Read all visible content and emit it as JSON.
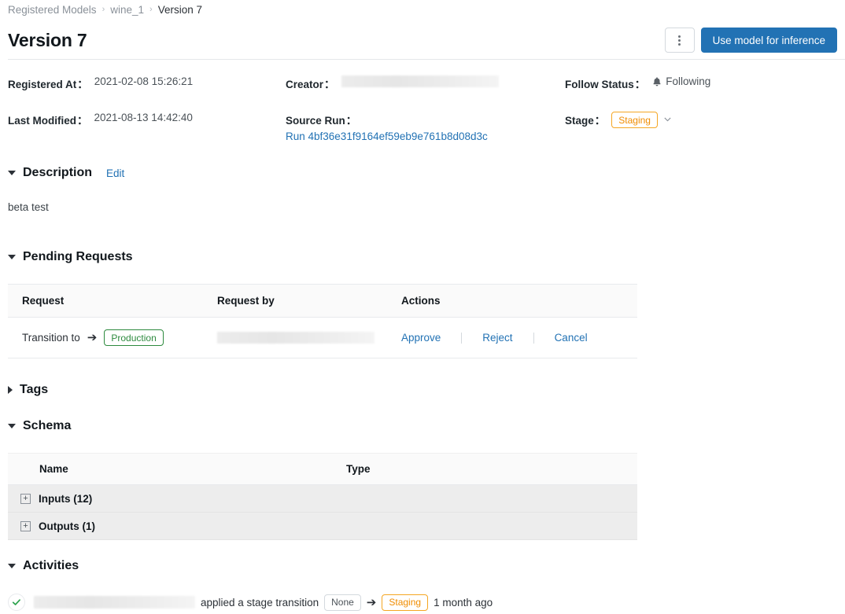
{
  "breadcrumb": {
    "items": [
      {
        "label": "Registered Models",
        "link": true
      },
      {
        "label": "wine_1",
        "link": true
      },
      {
        "label": "Version 7",
        "link": false
      }
    ],
    "separator": "›"
  },
  "header": {
    "title": "Version 7",
    "kebab_label": "More options",
    "primary_button": "Use model for inference"
  },
  "meta": {
    "registered_at_label": "Registered At",
    "registered_at_value": "2021-02-08 15:26:21",
    "last_modified_label": "Last Modified",
    "last_modified_value": "2021-08-13 14:42:40",
    "creator_label": "Creator",
    "creator_value": "",
    "source_run_label": "Source Run",
    "source_run_value": "Run 4bf36e31f9164ef59eb9e761b8d08d3c",
    "follow_status_label": "Follow Status",
    "follow_status_value": "Following",
    "follow_icon": "bell-icon",
    "stage_label": "Stage",
    "stage_value": "Staging",
    "stage_chevron": "⌄",
    "colon": "："
  },
  "description": {
    "heading": "Description",
    "edit_label": "Edit",
    "body": "beta test",
    "expanded": true
  },
  "pending_requests": {
    "heading": "Pending Requests",
    "expanded": true,
    "columns": [
      "Request",
      "Request by",
      "Actions"
    ],
    "rows": [
      {
        "request_prefix": "Transition to",
        "arrow": "➔",
        "request_stage": "Production",
        "requested_by": "",
        "actions": [
          "Approve",
          "Reject",
          "Cancel"
        ]
      }
    ]
  },
  "tags": {
    "heading": "Tags",
    "expanded": false
  },
  "schema": {
    "heading": "Schema",
    "expanded": true,
    "columns": [
      "Name",
      "Type"
    ],
    "rows": [
      {
        "expander": "+",
        "name": "Inputs (12)",
        "type": ""
      },
      {
        "expander": "+",
        "name": "Outputs (1)",
        "type": ""
      }
    ]
  },
  "activities": {
    "heading": "Activities",
    "expanded": true,
    "items": [
      {
        "status_icon": "check-circle-icon",
        "actor": "",
        "text": "applied a stage transition",
        "from_stage": "None",
        "arrow": "➔",
        "to_stage": "Staging",
        "time": "1 month ago"
      }
    ]
  },
  "colors": {
    "primary": "#2272b4",
    "link": "#2272b4",
    "staging": "#f08c00",
    "staging_border": "#f5a623",
    "production": "#2d8a3e",
    "success": "#2ea44f",
    "table_header_bg": "#fafafa",
    "schema_row_bg": "#ededed",
    "border": "#e8eaed",
    "muted_text": "#8a9199"
  }
}
